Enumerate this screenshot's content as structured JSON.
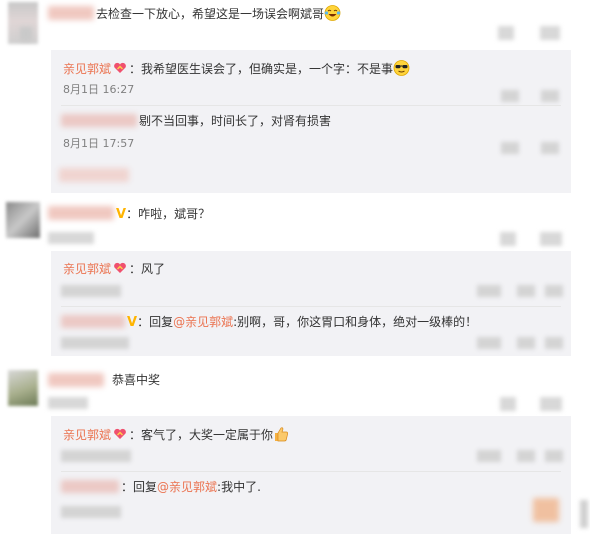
{
  "comments": [
    {
      "text": "去检查一下放心，希望这是一场误会啊斌哥",
      "replies": [
        {
          "author": "亲见郭斌",
          "text": "：我希望医生误会了，但确实是，一个字：不是事",
          "time": "8月1日 16:27"
        },
        {
          "text": "剔不当回事，时间长了，对肾有损害",
          "time": "8月1日 17:57"
        }
      ]
    },
    {
      "text": "：咋啦，斌哥？",
      "replies": [
        {
          "author": "亲见郭斌",
          "text": "：风了"
        },
        {
          "text": "：回复",
          "mention": "@亲见郭斌",
          "text_after": ":别啊，哥，你这胃口和身体，绝对一级棒的！"
        }
      ]
    },
    {
      "text": "恭喜中奖",
      "replies": [
        {
          "author": "亲见郭斌",
          "text": "：客气了，大奖一定属于你"
        },
        {
          "text": "：回复",
          "mention": "@亲见郭斌",
          "text_after": ":我中了."
        }
      ]
    }
  ],
  "colors": {
    "name": "#eb7350",
    "panel": "#f2f2f5",
    "time": "#808080",
    "verified": "#ffb400"
  },
  "icons": [
    "laughing-emoji-icon",
    "heart-badge-icon",
    "sunglasses-emoji-icon",
    "verified-v-icon",
    "thumbs-up-emoji-icon"
  ]
}
